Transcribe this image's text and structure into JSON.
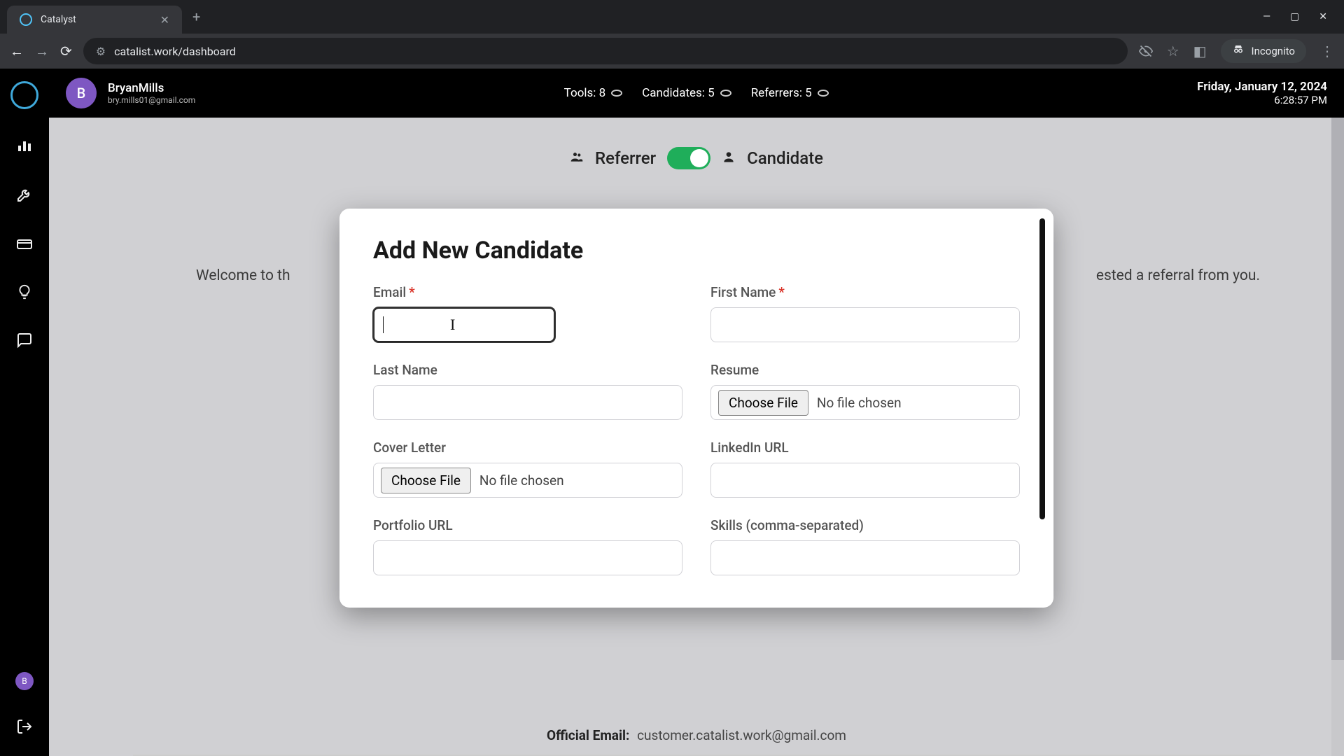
{
  "browser": {
    "tab_title": "Catalyst",
    "url": "catalist.work/dashboard",
    "incognito_label": "Incognito"
  },
  "header": {
    "user_name": "BryanMills",
    "user_email": "bry.mills01@gmail.com",
    "user_initial": "B",
    "stats": {
      "tools_label": "Tools: 8",
      "candidates_label": "Candidates: 5",
      "referrers_label": "Referrers: 5"
    },
    "date_line": "Friday, January 12, 2024",
    "time_line": "6:28:57 PM"
  },
  "toggle": {
    "left_label": "Referrer",
    "right_label": "Candidate"
  },
  "welcome": {
    "text_left": "Welcome to th",
    "text_right": "ested a referral from you."
  },
  "modal": {
    "title": "Add New Candidate",
    "fields": {
      "email_label": "Email",
      "first_name_label": "First Name",
      "last_name_label": "Last Name",
      "resume_label": "Resume",
      "cover_letter_label": "Cover Letter",
      "linkedin_label": "LinkedIn URL",
      "portfolio_label": "Portfolio URL",
      "skills_label": "Skills (comma-separated)",
      "choose_file_label": "Choose File",
      "no_file_label": "No file chosen"
    }
  },
  "footer": {
    "official_label": "Official Email:",
    "official_value": "customer.catalist.work@gmail.com"
  }
}
